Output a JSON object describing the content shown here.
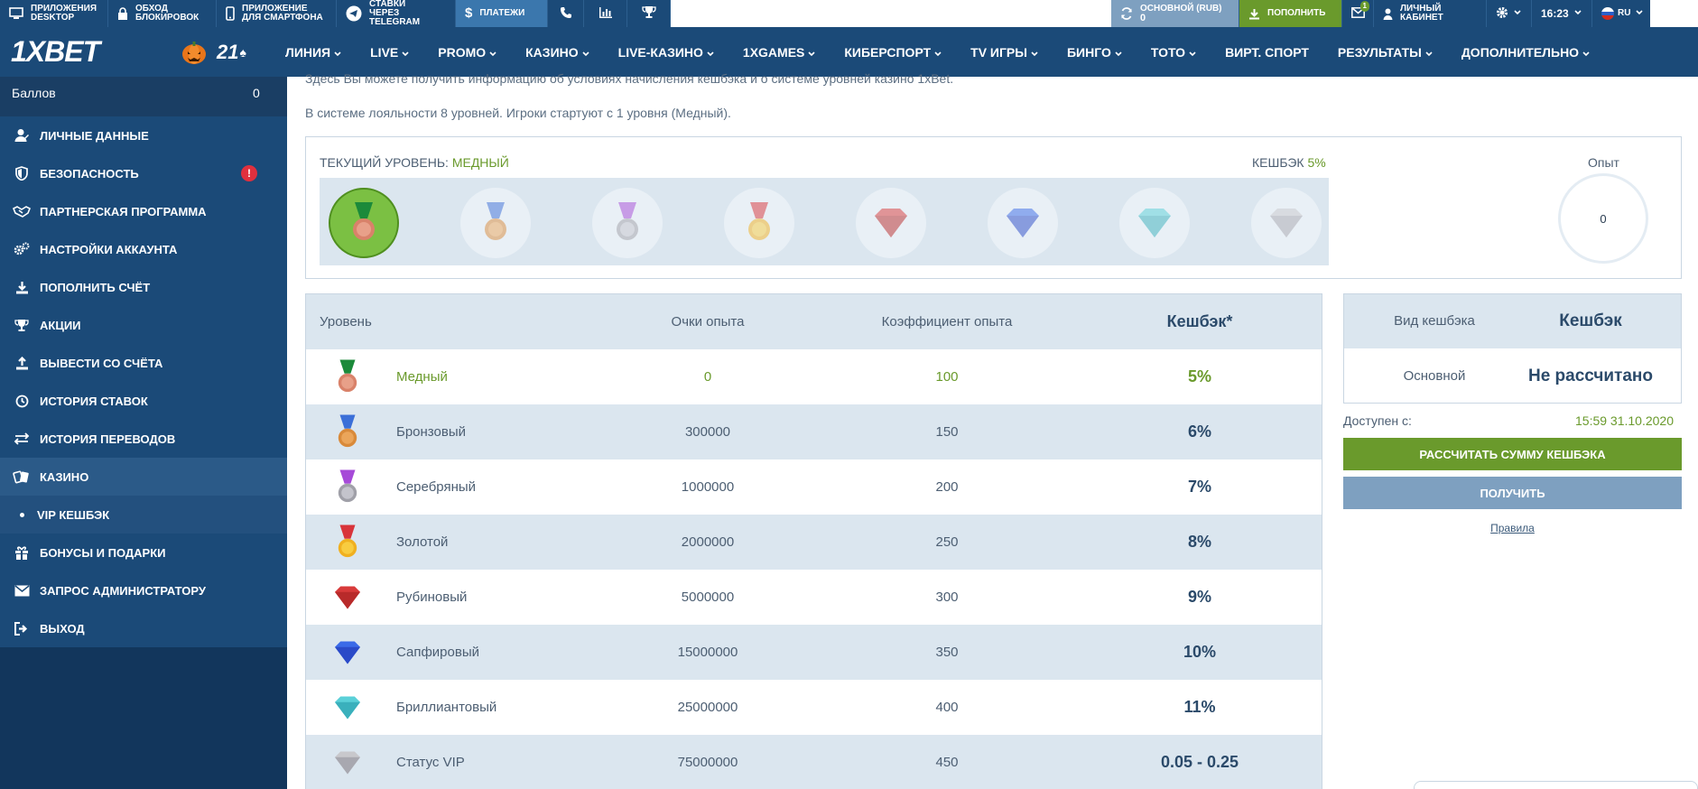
{
  "topbar": {
    "left": [
      {
        "line1": "ПРИЛОЖЕНИЯ",
        "line2": "DESKTOP",
        "icon": "monitor-icon"
      },
      {
        "line1": "ОБХОД",
        "line2": "БЛОКИРОВОК",
        "icon": "lock-icon"
      },
      {
        "line1": "ПРИЛОЖЕНИЕ",
        "line2": "ДЛЯ СМАРТФОНА",
        "icon": "phone-icon"
      },
      {
        "line1": "СТАВКИ",
        "line2": "ЧЕРЕЗ TELEGRAM",
        "icon": "telegram-icon"
      }
    ],
    "payments": "ПЛАТЕЖИ",
    "account_line1": "ОСНОВНОЙ (RUB)",
    "account_line2": "0",
    "deposit": "ПОПОЛНИТЬ",
    "messages_count": "1",
    "cabinet": "ЛИЧНЫЙ КАБИНЕТ",
    "time": "16:23",
    "lang": "RU"
  },
  "navbar": {
    "logo": "1XBET",
    "badge_21": "21",
    "items": [
      "ЛИНИЯ",
      "LIVE",
      "PROMO",
      "КАЗИНО",
      "LIVE-КАЗИНО",
      "1XGAMES",
      "КИБЕРСПОРТ",
      "TV ИГРЫ",
      "БИНГО",
      "ТОТО",
      "ВИРТ. СПОРТ",
      "РЕЗУЛЬТАТЫ",
      "ДОПОЛНИТЕЛЬНО"
    ]
  },
  "sidebar": {
    "points_label": "Баллов",
    "points_value": "0",
    "items": [
      {
        "label": "Личные данные",
        "icon": "user-icon"
      },
      {
        "label": "Безопасность",
        "icon": "shield-icon",
        "alert": "!"
      },
      {
        "label": "Партнерская программа",
        "icon": "handshake-icon"
      },
      {
        "label": "Настройки аккаунта",
        "icon": "gears-icon"
      },
      {
        "label": "Пополнить счёт",
        "icon": "download-icon"
      },
      {
        "label": "Акции",
        "icon": "trophy-icon"
      },
      {
        "label": "Вывести со счёта",
        "icon": "upload-icon"
      },
      {
        "label": "История ставок",
        "icon": "clock-icon"
      },
      {
        "label": "История переводов",
        "icon": "transfer-icon"
      },
      {
        "label": "Казино",
        "icon": "cards-icon"
      },
      {
        "label": "VIP КЕШБЭК",
        "icon": "dot-icon"
      },
      {
        "label": "Бонусы и подарки",
        "icon": "gift-icon"
      },
      {
        "label": "Запрос администратору",
        "icon": "mail-icon"
      },
      {
        "label": "Выход",
        "icon": "logout-icon"
      }
    ]
  },
  "main": {
    "intro1": "Здесь Вы можете получить информацию об условиях начисления кешбэка и о системе уровней казино 1xBet.",
    "intro2": "В системе лояльности 8 уровней. Игроки стартуют с 1 уровня (Медный).",
    "current_level_label": "ТЕКУЩИЙ УРОВЕНЬ:",
    "current_level_value": "МЕДНЫЙ",
    "cashback_label": "КЕШБЭК",
    "cashback_value": "5%",
    "experience_label": "Опыт",
    "experience_value": "0",
    "table": {
      "headers": [
        "Уровень",
        "Очки опыта",
        "Коэффициент опыта",
        "Кешбэк*"
      ],
      "rows": [
        {
          "name": "Медный",
          "points": "0",
          "coef": "100",
          "cashback": "5%"
        },
        {
          "name": "Бронзовый",
          "points": "300000",
          "coef": "150",
          "cashback": "6%"
        },
        {
          "name": "Серебряный",
          "points": "1000000",
          "coef": "200",
          "cashback": "7%"
        },
        {
          "name": "Золотой",
          "points": "2000000",
          "coef": "250",
          "cashback": "8%"
        },
        {
          "name": "Рубиновый",
          "points": "5000000",
          "coef": "300",
          "cashback": "9%"
        },
        {
          "name": "Сапфировый",
          "points": "15000000",
          "coef": "350",
          "cashback": "10%"
        },
        {
          "name": "Бриллиантовый",
          "points": "25000000",
          "coef": "400",
          "cashback": "11%"
        },
        {
          "name": "Статус VIP",
          "points": "75000000",
          "coef": "450",
          "cashback": "0.05 - 0.25"
        }
      ]
    },
    "cashback_box": {
      "type_label": "Вид кешбэка",
      "type_value": "Кешбэк",
      "main_label": "Основной",
      "main_value": "Не рассчитано"
    },
    "available_label": "Доступен с:",
    "available_value": "15:59 31.10.2020",
    "calc_button": "Рассчитать сумму кешбэка",
    "get_button": "Получить",
    "rules_link": "Правила"
  },
  "colors": {
    "brand": "#1b4a78",
    "accent_green": "#6a9a2c",
    "row_blue": "#dbe6ef"
  }
}
